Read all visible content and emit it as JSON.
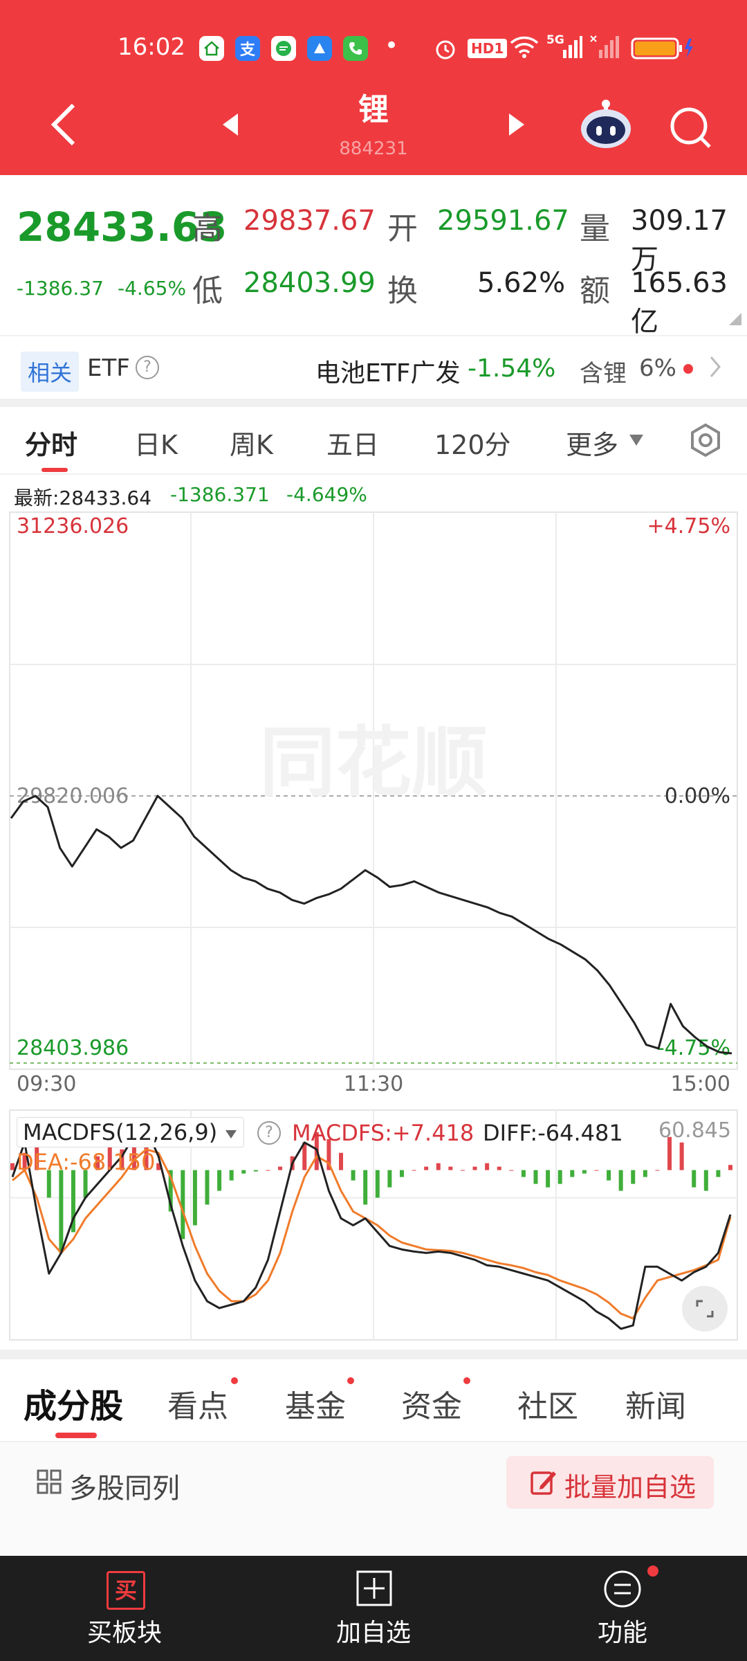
{
  "status_bar": {
    "time": "16:02",
    "apps": [
      "home-app",
      "alipay-app",
      "message-app",
      "browser-app",
      "phone-app"
    ],
    "alipay_char": "支",
    "more_dot": "•",
    "hd_badge": "HD1",
    "net": "5G"
  },
  "header": {
    "title": "锂",
    "subtitle": "884231"
  },
  "quote": {
    "price": "28433.63",
    "change": "-1386.37",
    "change_pct": "-4.65%",
    "high_label": "高",
    "high": "29837.67",
    "open_label": "开",
    "open": "29591.67",
    "volume_label": "量",
    "volume": "309.17万",
    "low_label": "低",
    "low": "28403.99",
    "turnover_label": "换",
    "turnover": "5.62%",
    "amount_label": "额",
    "amount": "165.63亿"
  },
  "etf": {
    "tag": "相关",
    "label": "ETF",
    "help": "?",
    "fund_name": "电池ETF广发",
    "fund_change": "-1.54%",
    "holding_label": "含锂",
    "holding_pct": "6%"
  },
  "chart_tabs": [
    "分时",
    "日K",
    "周K",
    "五日",
    "120分",
    "更多"
  ],
  "latest": {
    "label": "最新:28433.64",
    "change": "-1386.371",
    "pct": "-4.649%"
  },
  "colors": {
    "red": "#ef3b3f",
    "green": "#1a9a2a",
    "price_line": "#222222",
    "dea_line": "#f07b2a"
  },
  "chart_data": [
    {
      "type": "line",
      "title": "",
      "xlabel": "",
      "ylabel": "",
      "ylim": [
        28403.986,
        31236.026
      ],
      "y_ticks": [
        "31236.026",
        "29820.006",
        "28403.986"
      ],
      "right_ticks": [
        "+4.75%",
        "0.00%",
        "-4.75%"
      ],
      "x_ticks": [
        "09:30",
        "11:30",
        "15:00"
      ],
      "watermark": "同花顺",
      "series": [
        {
          "values": [
            29700,
            29790,
            29820,
            29760,
            29540,
            29440,
            29540,
            29640,
            29600,
            29540,
            29580,
            29700,
            29820,
            29760,
            29700,
            29600,
            29540,
            29480,
            29420,
            29380,
            29360,
            29320,
            29300,
            29260,
            29240,
            29270,
            29290,
            29320,
            29370,
            29420,
            29380,
            29330,
            29340,
            29360,
            29330,
            29300,
            29280,
            29260,
            29240,
            29220,
            29190,
            29170,
            29130,
            29090,
            29050,
            29020,
            28980,
            28940,
            28880,
            28800,
            28700,
            28600,
            28480,
            28460,
            28700,
            28580,
            28520,
            28470,
            28440,
            28433.64
          ]
        }
      ]
    },
    {
      "type": "bar",
      "title": "MACDFS(12,26,9)",
      "xlabel": "",
      "ylabel": "",
      "ylim": [
        -240,
        60.845
      ],
      "y_ticks": [
        "60.845"
      ],
      "legend": [
        "MACDFS:+7.418",
        "DIFF:-64.481",
        "DEA:-68.150"
      ],
      "series": [
        {
          "name": "MACDFS",
          "values": [
            10,
            25,
            35,
            -40,
            -120,
            -90,
            -40,
            20,
            45,
            30,
            55,
            45,
            10,
            -60,
            -100,
            -80,
            -50,
            -30,
            -15,
            -5,
            -2,
            0,
            5,
            20,
            40,
            55,
            45,
            25,
            -15,
            -50,
            -40,
            -25,
            -10,
            0,
            5,
            10,
            5,
            0,
            5,
            10,
            5,
            0,
            -10,
            -20,
            -25,
            -20,
            -10,
            -5,
            0,
            -15,
            -30,
            -20,
            -10,
            0,
            48,
            40,
            -25,
            -30,
            -10,
            7.418
          ]
        },
        {
          "name": "DIFF",
          "values": [
            -10,
            40,
            -60,
            -150,
            -120,
            -70,
            -40,
            -20,
            0,
            20,
            50,
            60,
            20,
            -50,
            -110,
            -160,
            -190,
            -200,
            -195,
            -190,
            -170,
            -130,
            -60,
            10,
            40,
            30,
            -30,
            -70,
            -80,
            -70,
            -90,
            -110,
            -115,
            -118,
            -120,
            -118,
            -120,
            -125,
            -130,
            -138,
            -140,
            -145,
            -150,
            -155,
            -160,
            -170,
            -180,
            -190,
            -205,
            -215,
            -230,
            -225,
            -140,
            -140,
            -150,
            -160,
            -148,
            -140,
            -120,
            -64.481
          ]
        },
        {
          "name": "DEA",
          "values": [
            -15,
            0,
            -40,
            -100,
            -120,
            -100,
            -70,
            -50,
            -30,
            -10,
            15,
            30,
            25,
            -10,
            -60,
            -110,
            -150,
            -175,
            -190,
            -190,
            -180,
            -160,
            -120,
            -60,
            -10,
            20,
            10,
            -30,
            -60,
            -70,
            -80,
            -95,
            -105,
            -110,
            -115,
            -116,
            -117,
            -120,
            -125,
            -130,
            -135,
            -138,
            -142,
            -148,
            -152,
            -160,
            -166,
            -172,
            -180,
            -192,
            -208,
            -215,
            -185,
            -160,
            -155,
            -150,
            -145,
            -138,
            -130,
            -68.15
          ]
        }
      ]
    }
  ],
  "macd": {
    "title": "MACDFS(12,26,9)",
    "help": "?",
    "macdfs": "MACDFS:+7.418",
    "diff": "DIFF:-64.481",
    "dea": "DEA:-68.150",
    "top_value": "60.845"
  },
  "section_tabs": [
    {
      "label": "成分股",
      "dot": false
    },
    {
      "label": "看点",
      "dot": true
    },
    {
      "label": "基金",
      "dot": true
    },
    {
      "label": "资金",
      "dot": true
    },
    {
      "label": "社区",
      "dot": false
    },
    {
      "label": "新闻",
      "dot": false
    }
  ],
  "list_controls": {
    "multi_label": "多股同列",
    "batch_label": "批量加自选"
  },
  "footer": {
    "buy_label": "买板块",
    "buy_icon_char": "买",
    "add_label": "加自选",
    "func_label": "功能"
  }
}
